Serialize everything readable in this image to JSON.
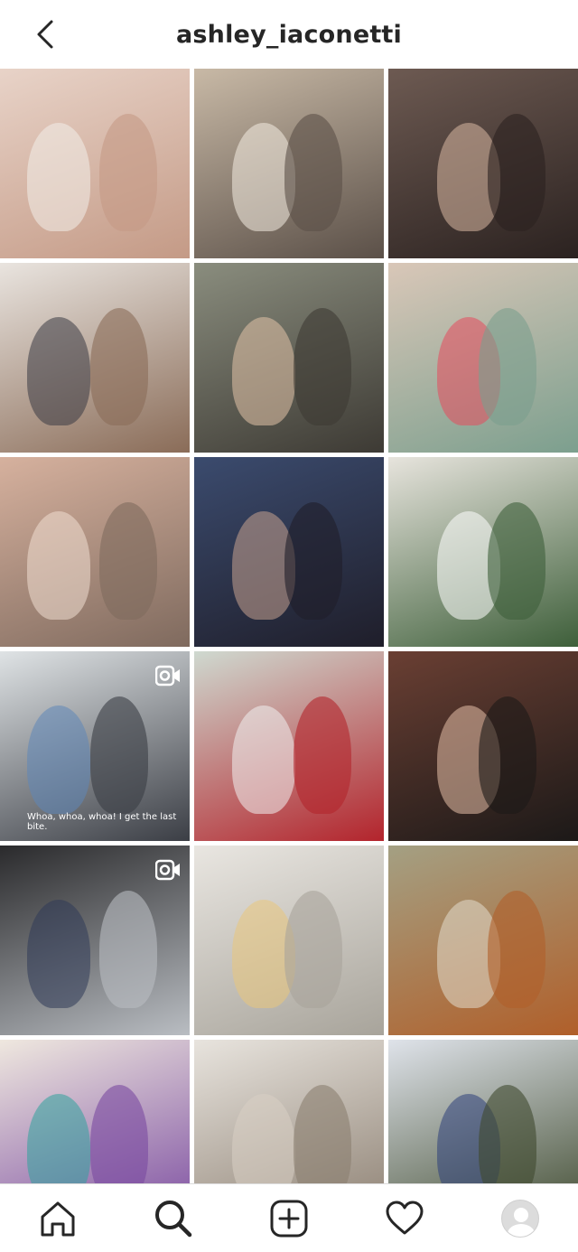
{
  "header": {
    "username": "ashley_iaconetti",
    "back_icon": "chevron-left-icon"
  },
  "grid": {
    "posts": [
      {
        "kind": "photo",
        "bg": [
          "#e8d3c8",
          "#c49a86"
        ],
        "accent": "#f2efe9"
      },
      {
        "kind": "photo",
        "bg": [
          "#c8b9a6",
          "#5b5048"
        ],
        "accent": "#f4ede2"
      },
      {
        "kind": "photo",
        "bg": [
          "#6d5a52",
          "#2b2220"
        ],
        "accent": "#d9b8a3"
      },
      {
        "kind": "photo",
        "bg": [
          "#e9e4df",
          "#8a6c58"
        ],
        "accent": "#3a3a44"
      },
      {
        "kind": "photo",
        "bg": [
          "#8a8d7e",
          "#3d3a34"
        ],
        "accent": "#e1c2a8"
      },
      {
        "kind": "photo",
        "bg": [
          "#d9c7b8",
          "#7c9f8e"
        ],
        "accent": "#e64b5c"
      },
      {
        "kind": "photo",
        "bg": [
          "#d6b19e",
          "#7f6a5e"
        ],
        "accent": "#f1dfd2"
      },
      {
        "kind": "photo",
        "bg": [
          "#3b4b6e",
          "#1f1e2a"
        ],
        "accent": "#c7a28f"
      },
      {
        "kind": "photo",
        "bg": [
          "#e7e4dd",
          "#3e5f3a"
        ],
        "accent": "#ffffff"
      },
      {
        "kind": "reel",
        "bg": [
          "#dfe3e5",
          "#3b3e45"
        ],
        "accent": "#5f86b8",
        "caption": "Whoa, whoa, whoa! I get the last bite."
      },
      {
        "kind": "photo",
        "bg": [
          "#cfd9d0",
          "#b3242c"
        ],
        "accent": "#f0f0f0"
      },
      {
        "kind": "photo",
        "bg": [
          "#6a3f33",
          "#1c1918"
        ],
        "accent": "#e6c0a8"
      },
      {
        "kind": "reel",
        "bg": [
          "#2a2a2c",
          "#b9bdc2"
        ],
        "accent": "#2f3b57",
        "caption": ""
      },
      {
        "kind": "photo",
        "bg": [
          "#e9e6e1",
          "#a8a49b"
        ],
        "accent": "#e9c77c"
      },
      {
        "kind": "photo",
        "bg": [
          "#a4a083",
          "#b05f2a"
        ],
        "accent": "#e2dccd"
      },
      {
        "kind": "photo",
        "bg": [
          "#efe8df",
          "#7a4aa0"
        ],
        "accent": "#2fa39c"
      },
      {
        "kind": "photo",
        "bg": [
          "#e8e4de",
          "#8b7e70"
        ],
        "accent": "#d9d0c4"
      },
      {
        "kind": "photo",
        "bg": [
          "#dfe3ea",
          "#3f4a2e"
        ],
        "accent": "#2d3f7a"
      },
      {
        "kind": "photo-cut",
        "bg": [
          "#b8262c",
          "#8e1d22"
        ],
        "accent": "#f0d6c4"
      },
      {
        "kind": "photo-cut",
        "bg": [
          "#4b4240",
          "#2c2625"
        ],
        "accent": "#d5b6a2"
      },
      {
        "kind": "photo-cut",
        "bg": [
          "#3a2f2c",
          "#6a5a50"
        ],
        "accent": "#e9e9e9"
      }
    ]
  },
  "tabbar": {
    "items": [
      {
        "name": "home-icon"
      },
      {
        "name": "search-icon"
      },
      {
        "name": "add-post-icon"
      },
      {
        "name": "heart-icon"
      },
      {
        "name": "profile-avatar"
      }
    ]
  }
}
